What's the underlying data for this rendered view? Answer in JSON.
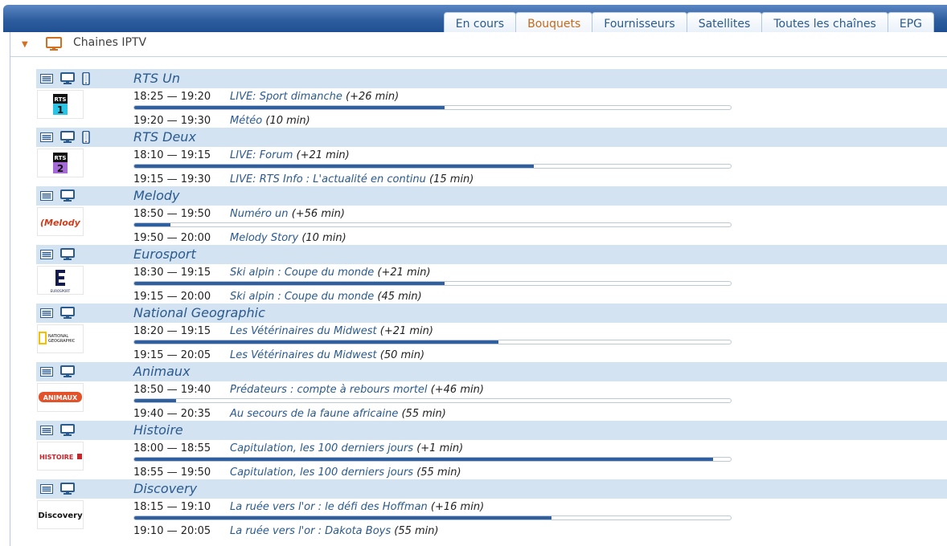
{
  "tabs": [
    {
      "label": "En cours",
      "active": false
    },
    {
      "label": "Bouquets",
      "active": true
    },
    {
      "label": "Fournisseurs",
      "active": false
    },
    {
      "label": "Satellites",
      "active": false
    },
    {
      "label": "Toutes les chaînes",
      "active": false
    },
    {
      "label": "EPG",
      "active": false
    }
  ],
  "panel": {
    "title": "Chaines IPTV"
  },
  "channels": [
    {
      "name": "RTS Un",
      "icons": [
        "list-icon",
        "tv-icon",
        "mobile-icon"
      ],
      "logo": "RTS 1",
      "now": {
        "time": "18:25 — 19:20",
        "title": "LIVE: Sport dimanche",
        "extra": "(+26 min)",
        "progress": 0.52
      },
      "next": {
        "time": "19:20 — 19:30",
        "title": "Météo",
        "extra": "(10 min)"
      }
    },
    {
      "name": "RTS Deux",
      "icons": [
        "list-icon",
        "tv-icon",
        "mobile-icon"
      ],
      "logo": "RTS 2",
      "now": {
        "time": "18:10 — 19:15",
        "title": "LIVE: Forum",
        "extra": "(+21 min)",
        "progress": 0.67
      },
      "next": {
        "time": "19:15 — 19:30",
        "title": "LIVE: RTS Info : L'actualité en continu",
        "extra": "(15 min)"
      }
    },
    {
      "name": "Melody",
      "icons": [
        "list-icon",
        "tv-icon"
      ],
      "logo": "Melody",
      "now": {
        "time": "18:50 — 19:50",
        "title": "Numéro un",
        "extra": "(+56 min)",
        "progress": 0.06
      },
      "next": {
        "time": "19:50 — 20:00",
        "title": "Melody Story",
        "extra": "(10 min)"
      }
    },
    {
      "name": "Eurosport",
      "icons": [
        "list-icon",
        "tv-icon"
      ],
      "logo": "EUROSPORT",
      "now": {
        "time": "18:30 — 19:15",
        "title": "Ski alpin : Coupe du monde",
        "extra": "(+21 min)",
        "progress": 0.52
      },
      "next": {
        "time": "19:15 — 20:00",
        "title": "Ski alpin : Coupe du monde",
        "extra": "(45 min)"
      }
    },
    {
      "name": "National Geographic",
      "icons": [
        "list-icon",
        "tv-icon"
      ],
      "logo": "NATIONAL GEOGRAPHIC",
      "now": {
        "time": "18:20 — 19:15",
        "title": "Les Vétérinaires du Midwest",
        "extra": "(+21 min)",
        "progress": 0.61
      },
      "next": {
        "time": "19:15 — 20:05",
        "title": "Les Vétérinaires du Midwest",
        "extra": "(50 min)"
      }
    },
    {
      "name": "Animaux",
      "icons": [
        "list-icon",
        "tv-icon"
      ],
      "logo": "ANIMAUX",
      "now": {
        "time": "18:50 — 19:40",
        "title": "Prédateurs : compte à rebours mortel",
        "extra": "(+46 min)",
        "progress": 0.07
      },
      "next": {
        "time": "19:40 — 20:35",
        "title": "Au secours de la faune africaine",
        "extra": "(55 min)"
      }
    },
    {
      "name": "Histoire",
      "icons": [
        "list-icon",
        "tv-icon"
      ],
      "logo": "HISTOIRE",
      "now": {
        "time": "18:00 — 18:55",
        "title": "Capitulation, les 100 derniers jours",
        "extra": "(+1 min)",
        "progress": 0.97
      },
      "next": {
        "time": "18:55 — 19:50",
        "title": "Capitulation, les 100 derniers jours",
        "extra": "(55 min)"
      }
    },
    {
      "name": "Discovery",
      "icons": [
        "list-icon",
        "tv-icon"
      ],
      "logo": "Discovery",
      "now": {
        "time": "18:15 — 19:10",
        "title": "La ruée vers l'or : le défi des Hoffman",
        "extra": "(+16 min)",
        "progress": 0.7
      },
      "next": {
        "time": "19:10 — 20:05",
        "title": "La ruée vers l'or : Dakota Boys",
        "extra": "(55 min)"
      }
    }
  ],
  "colors": {
    "header": "#2f5e9f",
    "row": "#d4e3f2",
    "progress": "#2f5f9f",
    "accent": "#c46a1c"
  }
}
